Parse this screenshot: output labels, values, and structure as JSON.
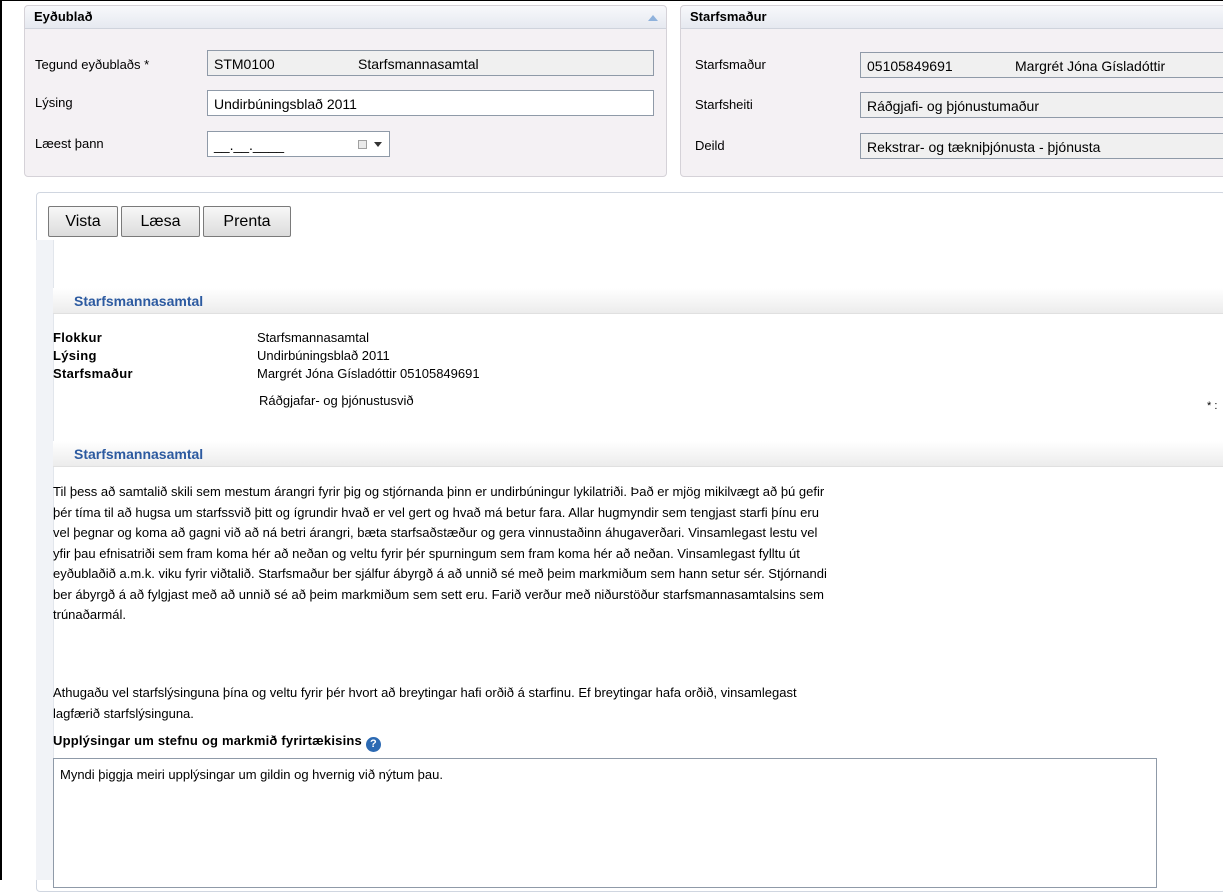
{
  "form_panel": {
    "title": "Eyðublað",
    "type_label": "Tegund eyðublaðs *",
    "type_code": "STM0100",
    "type_name": "Starfsmannasamtal",
    "description_label": "Lýsing",
    "description_value": "Undirbúningsblað 2011",
    "locked_label": "Læest þann",
    "locked_value": "__.__.____"
  },
  "employee_panel": {
    "title": "Starfsmaður",
    "employee_label": "Starfsmaður",
    "employee_id": "05105849691",
    "employee_name": "Margrét Jóna Gísladóttir",
    "job_title_label": "Starfsheiti",
    "job_title_value": "Ráðgjafi- og þjónustumaður",
    "department_label": "Deild",
    "department_value": "Rekstrar- og tækniþjónusta - þjónusta"
  },
  "toolbar": {
    "save_label": "Vista",
    "lock_label": "Læsa",
    "print_label": "Prenta"
  },
  "summary": {
    "heading": "Starfsmannasamtal",
    "category_label": "Flokkur",
    "category_value": "Starfsmannasamtal",
    "description_label": "Lýsing",
    "description_value": "Undirbúningsblað 2011",
    "employee_label": "Starfsmaður",
    "employee_value": "Margrét Jóna Gísladóttir 05105849691",
    "division_value": "Ráðgjafar- og þjónustusvið",
    "right_mark": "* :"
  },
  "intro": {
    "heading": "Starfsmannasamtal",
    "lines": [
      "Til þess að samtalið skili sem mestum árangri fyrir þig og stjórnanda þinn er undirbúningur lykilatriði. Það er mjög mikilvægt að þú gefir",
      "þér tíma til að hugsa um starfssvið þitt og ígrundir hvað er vel gert og hvað má betur fara. Allar hugmyndir sem tengjast starfi þínu eru",
      "vel þegnar og koma að gagni við að ná betri árangri, bæta starfsaðstæður og gera vinnustaðinn áhugaverðari. Vinsamlegast lestu vel",
      "yfir þau efnisatriði sem fram koma hér að neðan og veltu fyrir þér spurningum sem fram koma hér að neðan. Vinsamlegast fylltu út",
      "eyðublaðið a.m.k. viku fyrir viðtalið. Starfsmaður ber sjálfur ábyrgð á að unnið sé með þeim markmiðum sem hann setur sér. Stjórnandi",
      "ber ábyrgð á að fylgjast með að unnið sé að þeim markmiðum sem sett eru. Farið verður með niðurstöður starfsmannasamtalsins sem",
      "trúnaðarmál."
    ],
    "note_lines": [
      "Athugaðu vel starfslýsinguna þína og veltu fyrir þér hvort að breytingar hafi orðið á starfinu. Ef breytingar hafa orðið, vinsamlegast",
      "lagfærið starfslýsinguna."
    ]
  },
  "question": {
    "title": "Upplýsingar um stefnu og markmið fyrirtækisins",
    "help_icon": "?",
    "answer": "Myndi þiggja meiri upplýsingar um gildin og hvernig við nýtum þau."
  }
}
